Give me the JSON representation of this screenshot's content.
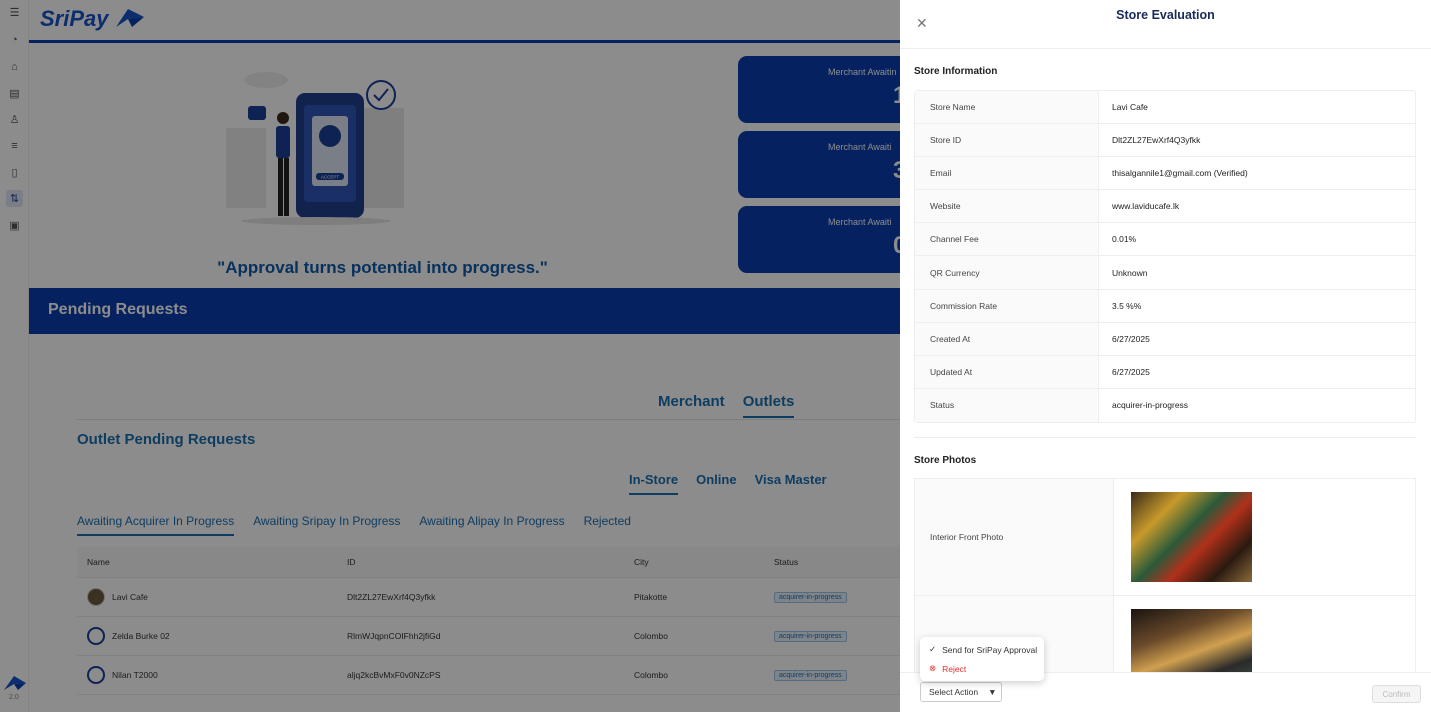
{
  "app": {
    "name": "SriPay",
    "version": "2.0"
  },
  "sidebar": {
    "icons": [
      "menu-icon",
      "dashboard-icon",
      "home-icon",
      "bank-icon",
      "user-icon",
      "list-icon",
      "document-icon",
      "transfer-icon",
      "report-icon"
    ],
    "active_index": 7
  },
  "hero": {
    "quote": "\"Approval turns potential into progress.\"",
    "accept_text": "ACCEPT",
    "stats": [
      {
        "label": "Merchant Awaitin",
        "value": "1"
      },
      {
        "label": "Merchant Awaiti",
        "value": "3"
      },
      {
        "label": "Merchant Awaiti",
        "value": "0"
      }
    ]
  },
  "pending": {
    "title": "Pending Requests",
    "main_tabs": [
      "Merchant",
      "Outlets"
    ],
    "active_main_tab": "Outlets",
    "outlet_title": "Outlet Pending Requests",
    "channel_tabs": [
      "In-Store",
      "Online",
      "Visa Master"
    ],
    "active_channel": "In-Store",
    "status_tabs": [
      "Awaiting Acquirer In Progress",
      "Awaiting Sripay In Progress",
      "Awaiting Alipay In Progress",
      "Rejected"
    ],
    "active_status_tab": "Awaiting Acquirer In Progress",
    "columns": [
      "Name",
      "ID",
      "City",
      "Status"
    ],
    "rows": [
      {
        "name": "Lavi Cafe",
        "id": "Dlt2ZL27EwXrf4Q3yfkk",
        "city": "Pitakotte",
        "status": "acquirer-in-progress"
      },
      {
        "name": "Zelda Burke 02",
        "id": "RlmWJqpnCOIFhh2jfiGd",
        "city": "Colombo",
        "status": "acquirer-in-progress"
      },
      {
        "name": "Nilan T2000",
        "id": "aljq2kcBvMxF0v0NZcPS",
        "city": "Colombo",
        "status": "acquirer-in-progress"
      }
    ]
  },
  "drawer": {
    "title": "Store Evaluation",
    "store_info_title": "Store Information",
    "store_info": [
      {
        "key": "Store Name",
        "value": "Lavi Cafe"
      },
      {
        "key": "Store ID",
        "value": "Dlt2ZL27EwXrf4Q3yfkk"
      },
      {
        "key": "Email",
        "value": "thisalgannile1@gmail.com (Verified)"
      },
      {
        "key": "Website",
        "value": "www.laviducafe.lk"
      },
      {
        "key": "Channel Fee",
        "value": "0.01%"
      },
      {
        "key": "QR Currency",
        "value": "Unknown"
      },
      {
        "key": "Commission Rate",
        "value": "3.5 %%"
      },
      {
        "key": "Created At",
        "value": "6/27/2025"
      },
      {
        "key": "Updated At",
        "value": "6/27/2025"
      },
      {
        "key": "Status",
        "value": "acquirer-in-progress"
      }
    ],
    "photos_title": "Store Photos",
    "photos": [
      {
        "label": "Interior Front Photo"
      },
      {
        "label": ""
      }
    ],
    "select_action": "Select Action",
    "confirm_label": "Confirm",
    "menu": {
      "approve": "Send for SriPay Approval",
      "reject": "Reject"
    }
  }
}
